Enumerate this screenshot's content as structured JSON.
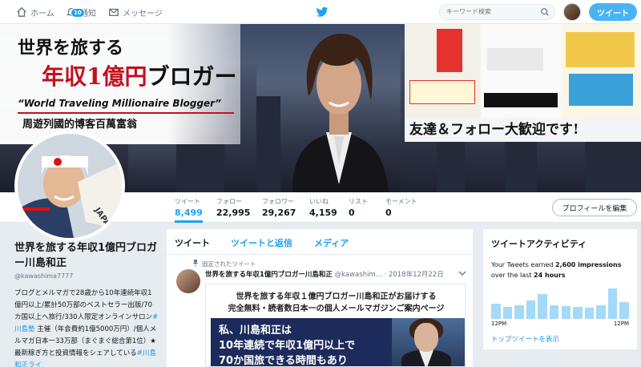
{
  "nav": {
    "home": "ホーム",
    "notifications": "通知",
    "notifications_badge": "10",
    "messages": "メッセージ",
    "search_placeholder": "キーワード検索",
    "tweet_button": "ツイート"
  },
  "banner": {
    "title_line1": "世界を旅する",
    "title_line2_red": "年収1億円",
    "title_line2_black": "ブロガー",
    "english": "“World Traveling Millionaire Blogger”",
    "chinese": "周遊列國的博客百萬富翁",
    "welcome": "友達＆フォロー大歓迎です!"
  },
  "stats": [
    {
      "label": "ツイート",
      "value": "8,499"
    },
    {
      "label": "フォロー",
      "value": "22,995"
    },
    {
      "label": "フォロワー",
      "value": "29,267"
    },
    {
      "label": "いいね",
      "value": "4,159"
    },
    {
      "label": "リスト",
      "value": "0"
    },
    {
      "label": "モーメント",
      "value": "0"
    }
  ],
  "edit_profile": "プロフィールを編集",
  "profile": {
    "name": "世界を旅する年収1億円ブロガー川島和正",
    "handle": "@kawashima7777",
    "bio_1": "ブログとメルマガで28歳から10年連続年収1億円以上/累計50万部のベストセラー出版/70カ国以上へ旅行/330人限定オンラインサロン",
    "bio_link1": "#川島塾",
    "bio_2": " 主催（年会費約1億5000万円）/個人メルマガ日本一33万部（まぐまぐ総合第1位）★最新稼ぎ方と投資情報をシェアしている",
    "bio_link2": "#川島和正ライ"
  },
  "timeline": {
    "tabs": [
      "ツイート",
      "ツイートと返信",
      "メディア"
    ],
    "pinned_label": "固定されたツイート",
    "tweet_name": "世界を旅する年収1億円ブロガー川島和正",
    "tweet_handle": "@kawashim...",
    "tweet_date": "· 2018年12月22日",
    "media_line1": "世界を旅する年収１億円ブロガー川島和正がお届けする",
    "media_line2": "完全無料・読者数日本一の個人メールマガジンご案内ページ",
    "media_big1": "私、川島和正は",
    "media_big2": "10年連続で年収1億円以上で",
    "media_big3": "70か国旅できる時間もあり"
  },
  "activity": {
    "title": "ツイートアクティビティ",
    "text_pre": "Your Tweets earned ",
    "impressions": "2,600 impressions",
    "text_mid": " over the last ",
    "period": "24 hours",
    "axis_left": "12PM",
    "axis_right": "12PM",
    "bars": [
      0.45,
      0.35,
      0.4,
      0.55,
      0.75,
      0.4,
      0.38,
      0.35,
      0.33,
      0.4,
      0.9,
      0.5
    ],
    "top_tweets_link": "トップツイートを表示"
  },
  "colors": {
    "accent": "#1da1f2",
    "banner_red": "#c1121c",
    "navy": "#1d2b5c"
  }
}
